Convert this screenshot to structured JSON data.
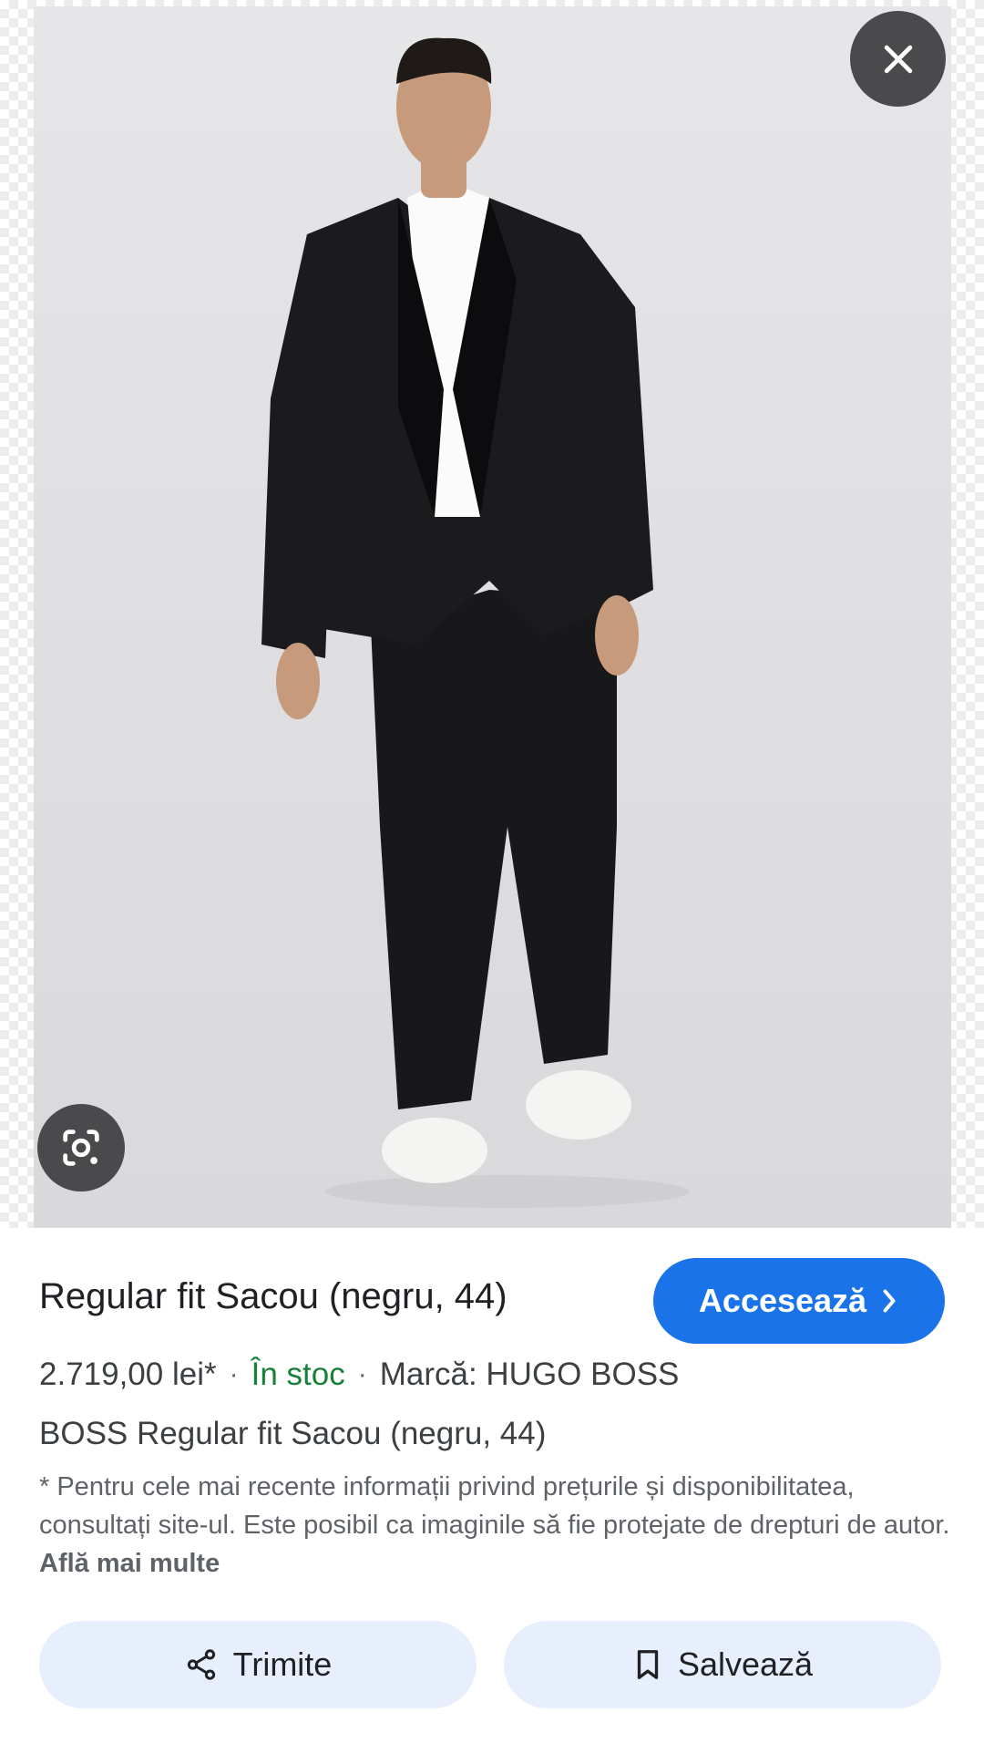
{
  "product": {
    "title": "Regular fit Sacou (negru, 44)",
    "price": "2.719,00 lei*",
    "stock": "În stoc",
    "brand": "Marcă: HUGO BOSS",
    "full_name": "BOSS Regular fit Sacou (negru, 44)"
  },
  "visit_button": {
    "label": "Accesează",
    "icon": "chevron-right-icon"
  },
  "meta": {
    "separator": "·"
  },
  "disclaimer": {
    "text": "* Pentru cele mai recente informații privind prețurile și disponibilitatea, consultați site-ul. Este posibil ca imaginile să fie protejate de drepturi de autor. ",
    "link": "Află mai multe"
  },
  "actions": {
    "share_label": "Trimite",
    "share_icon": "share-icon",
    "save_label": "Salvează",
    "save_icon": "bookmark-icon"
  },
  "viewer": {
    "close_icon": "close-icon",
    "lens_icon": "lens-icon"
  },
  "colors": {
    "accent": "#1a73e8",
    "stock": "#188038",
    "action_bg": "#e8effc",
    "overlay_button": "#4a4a4c"
  }
}
